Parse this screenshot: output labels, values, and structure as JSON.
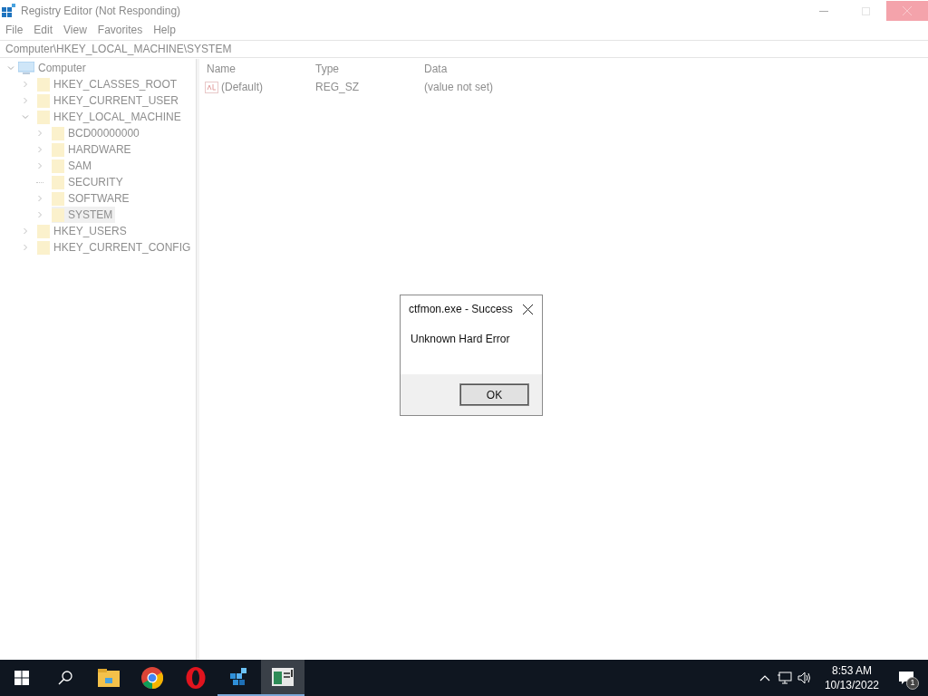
{
  "window": {
    "title": "Registry Editor (Not Responding)",
    "menu": [
      "File",
      "Edit",
      "View",
      "Favorites",
      "Help"
    ],
    "address": "Computer\\HKEY_LOCAL_MACHINE\\SYSTEM"
  },
  "tree": {
    "label": "Computer",
    "expanded": true,
    "children": [
      {
        "label": "HKEY_CLASSES_ROOT",
        "expandable": true,
        "selected": false
      },
      {
        "label": "HKEY_CURRENT_USER",
        "expandable": true,
        "selected": false
      },
      {
        "label": "HKEY_LOCAL_MACHINE",
        "expandable": true,
        "expanded": true,
        "selected": false,
        "children": [
          {
            "label": "BCD00000000",
            "expandable": true,
            "selected": false
          },
          {
            "label": "HARDWARE",
            "expandable": true,
            "selected": false
          },
          {
            "label": "SAM",
            "expandable": true,
            "selected": false
          },
          {
            "label": "SECURITY",
            "expandable": false,
            "selected": false
          },
          {
            "label": "SOFTWARE",
            "expandable": true,
            "selected": false
          },
          {
            "label": "SYSTEM",
            "expandable": true,
            "selected": true
          }
        ]
      },
      {
        "label": "HKEY_USERS",
        "expandable": true,
        "selected": false
      },
      {
        "label": "HKEY_CURRENT_CONFIG",
        "expandable": true,
        "selected": false
      }
    ]
  },
  "values": {
    "columns": [
      "Name",
      "Type",
      "Data"
    ],
    "rows": [
      {
        "name": "(Default)",
        "type": "REG_SZ",
        "data": "(value not set)"
      }
    ]
  },
  "dialog": {
    "title": "ctfmon.exe - Success",
    "message": "Unknown Hard Error",
    "button": "OK"
  },
  "taskbar": {
    "apps": [
      {
        "kind": "explorer",
        "active": false
      },
      {
        "kind": "chrome",
        "active": false
      },
      {
        "kind": "opera",
        "active": false
      },
      {
        "kind": "regedit",
        "active": false
      },
      {
        "kind": "window",
        "active": true
      }
    ],
    "time": "8:53 AM",
    "date": "10/13/2022",
    "notifications": "1"
  }
}
